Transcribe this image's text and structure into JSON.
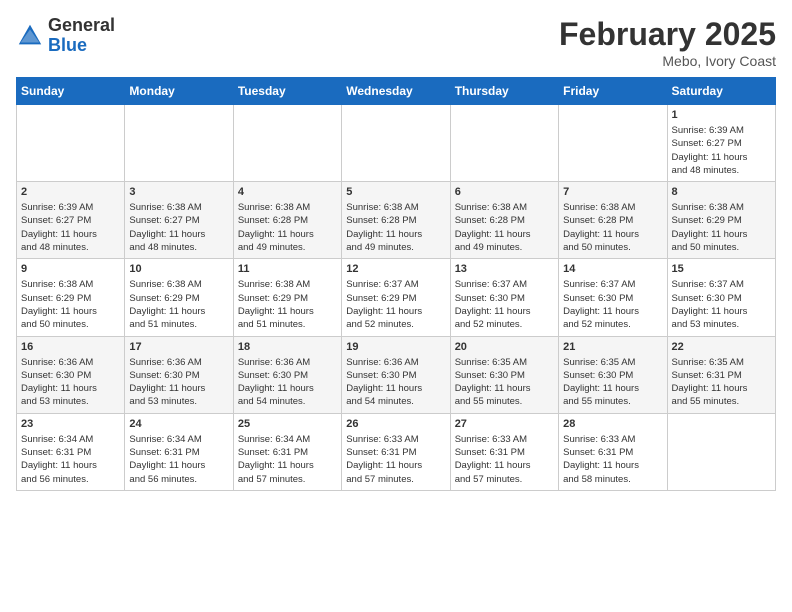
{
  "header": {
    "logo_general": "General",
    "logo_blue": "Blue",
    "month_title": "February 2025",
    "subtitle": "Mebo, Ivory Coast"
  },
  "days_of_week": [
    "Sunday",
    "Monday",
    "Tuesday",
    "Wednesday",
    "Thursday",
    "Friday",
    "Saturday"
  ],
  "weeks": [
    [
      {
        "day": "",
        "info": ""
      },
      {
        "day": "",
        "info": ""
      },
      {
        "day": "",
        "info": ""
      },
      {
        "day": "",
        "info": ""
      },
      {
        "day": "",
        "info": ""
      },
      {
        "day": "",
        "info": ""
      },
      {
        "day": "1",
        "info": "Sunrise: 6:39 AM\nSunset: 6:27 PM\nDaylight: 11 hours\nand 48 minutes."
      }
    ],
    [
      {
        "day": "2",
        "info": "Sunrise: 6:39 AM\nSunset: 6:27 PM\nDaylight: 11 hours\nand 48 minutes."
      },
      {
        "day": "3",
        "info": "Sunrise: 6:38 AM\nSunset: 6:27 PM\nDaylight: 11 hours\nand 48 minutes."
      },
      {
        "day": "4",
        "info": "Sunrise: 6:38 AM\nSunset: 6:28 PM\nDaylight: 11 hours\nand 49 minutes."
      },
      {
        "day": "5",
        "info": "Sunrise: 6:38 AM\nSunset: 6:28 PM\nDaylight: 11 hours\nand 49 minutes."
      },
      {
        "day": "6",
        "info": "Sunrise: 6:38 AM\nSunset: 6:28 PM\nDaylight: 11 hours\nand 49 minutes."
      },
      {
        "day": "7",
        "info": "Sunrise: 6:38 AM\nSunset: 6:28 PM\nDaylight: 11 hours\nand 50 minutes."
      },
      {
        "day": "8",
        "info": "Sunrise: 6:38 AM\nSunset: 6:29 PM\nDaylight: 11 hours\nand 50 minutes."
      }
    ],
    [
      {
        "day": "9",
        "info": "Sunrise: 6:38 AM\nSunset: 6:29 PM\nDaylight: 11 hours\nand 50 minutes."
      },
      {
        "day": "10",
        "info": "Sunrise: 6:38 AM\nSunset: 6:29 PM\nDaylight: 11 hours\nand 51 minutes."
      },
      {
        "day": "11",
        "info": "Sunrise: 6:38 AM\nSunset: 6:29 PM\nDaylight: 11 hours\nand 51 minutes."
      },
      {
        "day": "12",
        "info": "Sunrise: 6:37 AM\nSunset: 6:29 PM\nDaylight: 11 hours\nand 52 minutes."
      },
      {
        "day": "13",
        "info": "Sunrise: 6:37 AM\nSunset: 6:30 PM\nDaylight: 11 hours\nand 52 minutes."
      },
      {
        "day": "14",
        "info": "Sunrise: 6:37 AM\nSunset: 6:30 PM\nDaylight: 11 hours\nand 52 minutes."
      },
      {
        "day": "15",
        "info": "Sunrise: 6:37 AM\nSunset: 6:30 PM\nDaylight: 11 hours\nand 53 minutes."
      }
    ],
    [
      {
        "day": "16",
        "info": "Sunrise: 6:36 AM\nSunset: 6:30 PM\nDaylight: 11 hours\nand 53 minutes."
      },
      {
        "day": "17",
        "info": "Sunrise: 6:36 AM\nSunset: 6:30 PM\nDaylight: 11 hours\nand 53 minutes."
      },
      {
        "day": "18",
        "info": "Sunrise: 6:36 AM\nSunset: 6:30 PM\nDaylight: 11 hours\nand 54 minutes."
      },
      {
        "day": "19",
        "info": "Sunrise: 6:36 AM\nSunset: 6:30 PM\nDaylight: 11 hours\nand 54 minutes."
      },
      {
        "day": "20",
        "info": "Sunrise: 6:35 AM\nSunset: 6:30 PM\nDaylight: 11 hours\nand 55 minutes."
      },
      {
        "day": "21",
        "info": "Sunrise: 6:35 AM\nSunset: 6:30 PM\nDaylight: 11 hours\nand 55 minutes."
      },
      {
        "day": "22",
        "info": "Sunrise: 6:35 AM\nSunset: 6:31 PM\nDaylight: 11 hours\nand 55 minutes."
      }
    ],
    [
      {
        "day": "23",
        "info": "Sunrise: 6:34 AM\nSunset: 6:31 PM\nDaylight: 11 hours\nand 56 minutes."
      },
      {
        "day": "24",
        "info": "Sunrise: 6:34 AM\nSunset: 6:31 PM\nDaylight: 11 hours\nand 56 minutes."
      },
      {
        "day": "25",
        "info": "Sunrise: 6:34 AM\nSunset: 6:31 PM\nDaylight: 11 hours\nand 57 minutes."
      },
      {
        "day": "26",
        "info": "Sunrise: 6:33 AM\nSunset: 6:31 PM\nDaylight: 11 hours\nand 57 minutes."
      },
      {
        "day": "27",
        "info": "Sunrise: 6:33 AM\nSunset: 6:31 PM\nDaylight: 11 hours\nand 57 minutes."
      },
      {
        "day": "28",
        "info": "Sunrise: 6:33 AM\nSunset: 6:31 PM\nDaylight: 11 hours\nand 58 minutes."
      },
      {
        "day": "",
        "info": ""
      }
    ]
  ]
}
